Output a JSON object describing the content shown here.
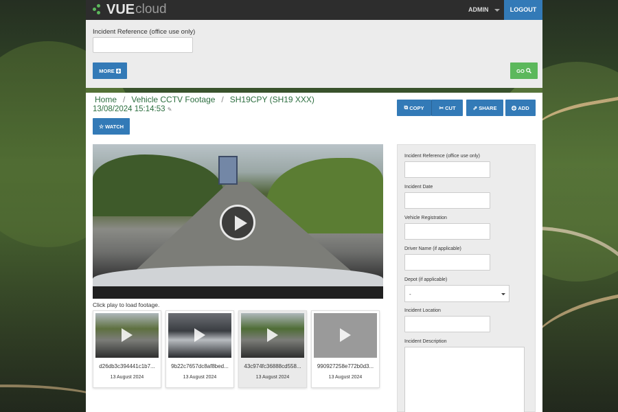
{
  "header": {
    "logo_bold": "VUE",
    "logo_light": "cloud",
    "user_menu": "ADMIN",
    "logout_label": "LOGOUT"
  },
  "search": {
    "label": "Incident Reference (office use only)",
    "value": "",
    "more_label": "MORE",
    "more_icon": "plus-square-icon",
    "go_label": "GO",
    "go_icon": "search-icon"
  },
  "breadcrumb": {
    "items": [
      "Home",
      "Vehicle CCTV Footage",
      "SH19CPY (SH19 XXX)"
    ],
    "separator": "/"
  },
  "datetime": "13/08/2024 15:14:53",
  "toolbar": {
    "copy_label": "COPY",
    "cut_label": "CUT",
    "share_label": "SHARE",
    "add_label": "ADD",
    "watch_label": "WATCH"
  },
  "video": {
    "hint": "Click play to load footage."
  },
  "thumbnails": [
    {
      "name": "d26db3c394441c1b7...",
      "date": "13 August 2024"
    },
    {
      "name": "9b22c7657dc8af8bed...",
      "date": "13 August 2024"
    },
    {
      "name": "43c974fc36888cd558...",
      "date": "13 August 2024",
      "selected": true
    },
    {
      "name": "990927258e772b0d3...",
      "date": "13 August 2024"
    }
  ],
  "form": {
    "incident_reference_label": "Incident Reference (office use only)",
    "incident_date_label": "Incident Date",
    "vehicle_registration_label": "Vehicle Registration",
    "driver_name_label": "Driver Name (if applicable)",
    "depot_label": "Depot (if applicable)",
    "depot_value": "-",
    "incident_location_label": "Incident Location",
    "incident_description_label": "Incident Description"
  },
  "colors": {
    "primary": "#337ab7",
    "success": "#5cb85c",
    "link": "#2c6e3f",
    "topbar": "#2d2d2d"
  }
}
